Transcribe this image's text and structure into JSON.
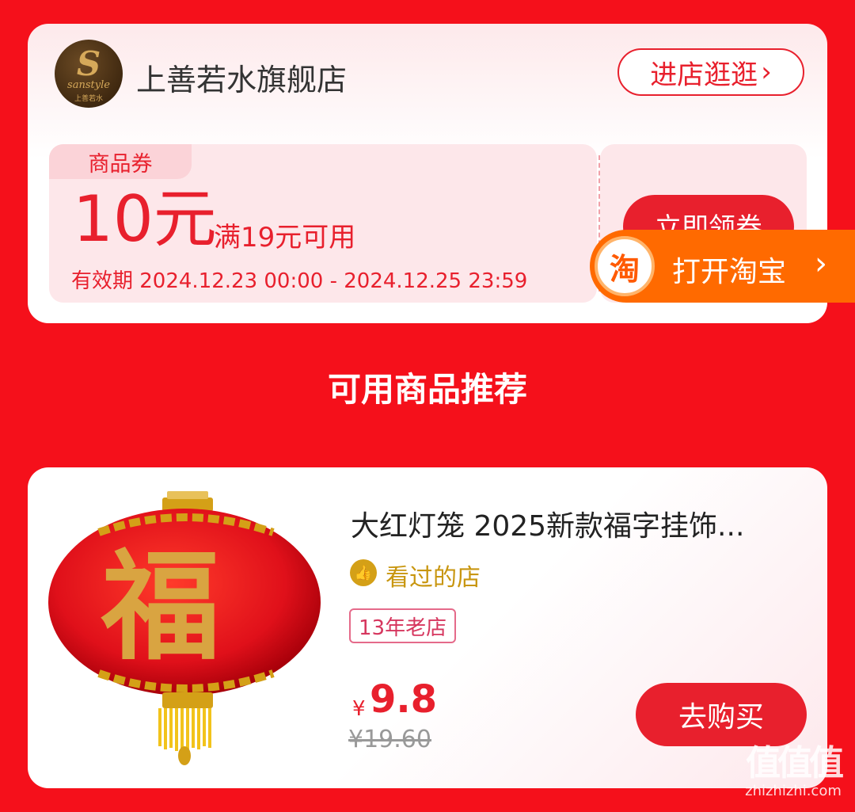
{
  "store": {
    "logo_letter": "S",
    "logo_brand": "sanstyle",
    "logo_cn": "上善若水",
    "name": "上善若水旗舰店",
    "visit_label": "进店逛逛",
    "visit_chevron": "›"
  },
  "coupon": {
    "tag": "商品券",
    "amount": "10元",
    "condition": "满19元可用",
    "validity": "有效期 2024.12.23 00:00 - 2024.12.25 23:59",
    "claim_label": "立即领券"
  },
  "taobao_banner": {
    "icon_char": "淘",
    "label": "打开淘宝",
    "chevron": "›",
    "color": "#ff6a00"
  },
  "section_title": "可用商品推荐",
  "product": {
    "title": "大红灯笼 2025新款福字挂饰...",
    "lantern_char": "福",
    "seen_icon": "thumbs-up-icon",
    "seen_label": "看过的店",
    "shop_age": "13年老店",
    "currency": "¥",
    "price": "9.8",
    "original_price": "¥19.60",
    "buy_label": "去购买"
  },
  "watermark": {
    "icon": "值值值",
    "text": "zhizhizhi.com"
  },
  "colors": {
    "background": "#f5101b",
    "accent": "#e8202d"
  }
}
